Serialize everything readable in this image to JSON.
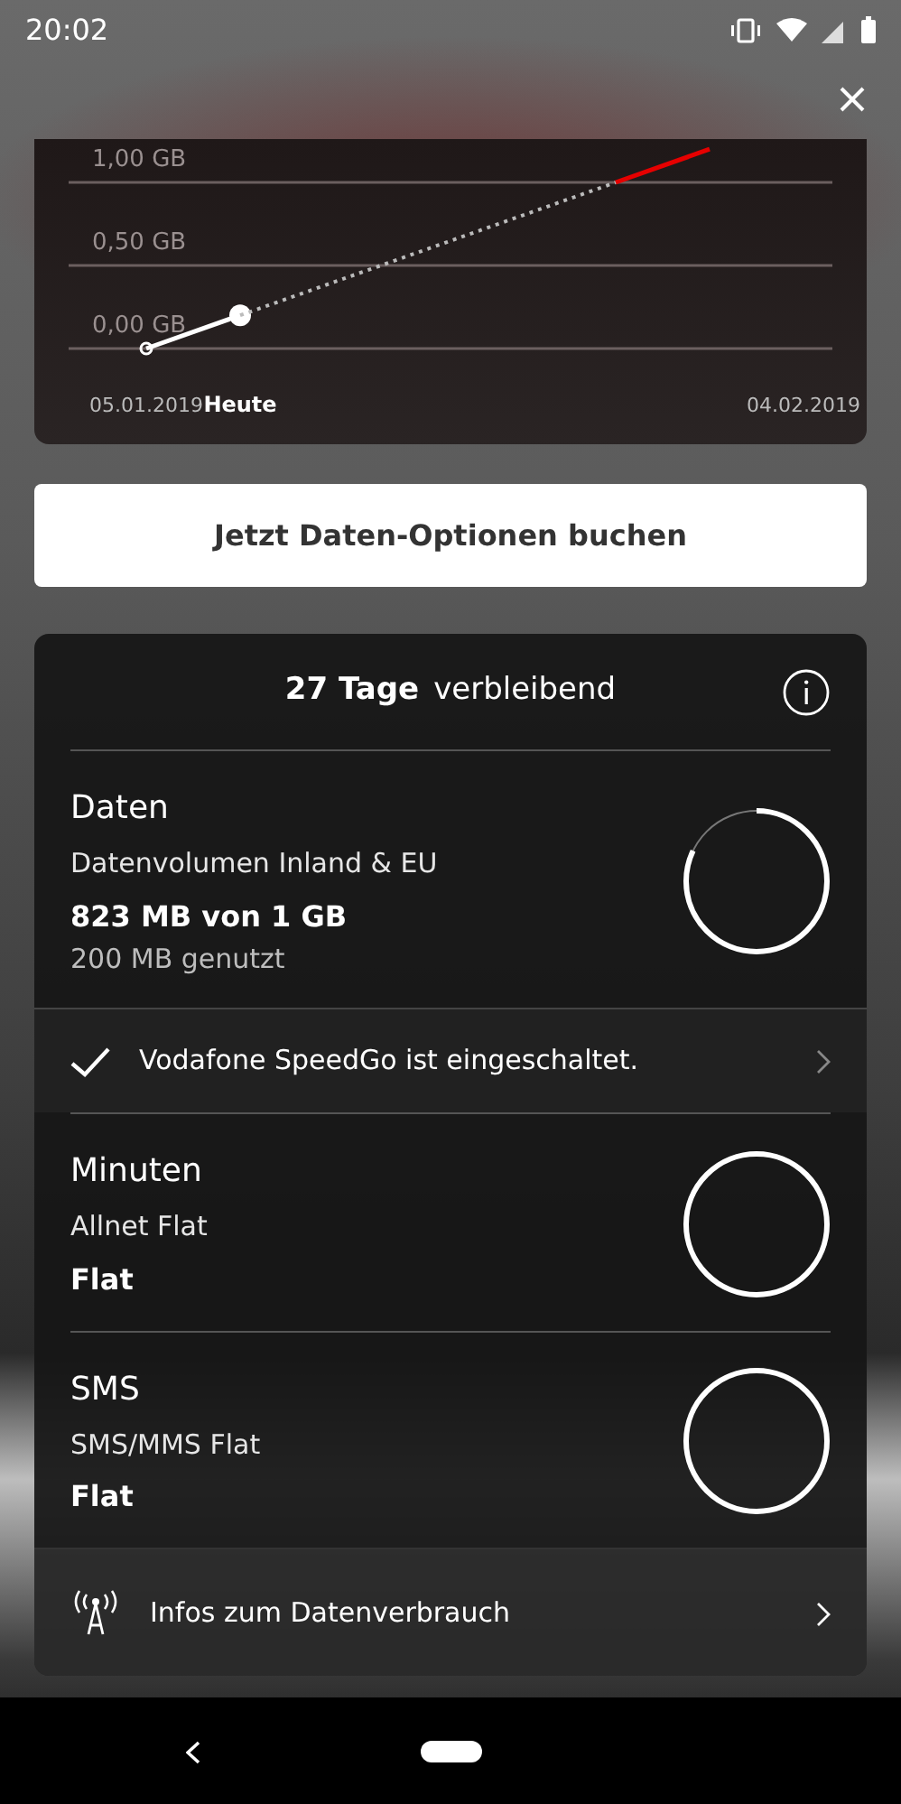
{
  "status_bar": {
    "time": "20:02"
  },
  "chart_card": {
    "chart_data": {
      "type": "line",
      "categories": [
        "05.01.2019",
        "Heute",
        null,
        null,
        null,
        null,
        null,
        "04.02.2019"
      ],
      "yticks": [
        {
          "value": 0,
          "label": "0,00 GB"
        },
        {
          "value": 0.5,
          "label": "0,50 GB"
        },
        {
          "value": 1,
          "label": "1,00 GB"
        }
      ],
      "ylim": [
        0,
        1.25
      ],
      "series": [
        {
          "color": "#ffffff",
          "line_style": "solid",
          "marker": "circle",
          "values": [
            0,
            0.2,
            null,
            null,
            null,
            null,
            null,
            null
          ]
        },
        {
          "color": "#bbbbbb",
          "line_style": "dotted",
          "values": [
            null,
            0.2,
            0.4,
            0.6,
            0.8,
            1.0,
            null,
            null
          ]
        },
        {
          "color": "#e60000",
          "line_style": "solid",
          "values": [
            null,
            null,
            null,
            null,
            null,
            1.0,
            1.2,
            null
          ]
        }
      ]
    }
  },
  "book_button": "Jetzt Daten-Optionen buchen",
  "summary": {
    "days": "27 Tage",
    "days_suffix": "verbleibend",
    "rows": [
      {
        "kind": "usage",
        "title": "Daten",
        "plan": "Datenvolumen Inland & EU",
        "amount": "823 MB von 1 GB",
        "used": "200 MB genutzt"
      },
      {
        "kind": "notice",
        "text": "Vodafone SpeedGo ist eingeschaltet.",
        "checked": true
      },
      {
        "kind": "usage",
        "title": "Minuten",
        "plan": "Allnet Flat",
        "amount": "Flat"
      },
      {
        "kind": "usage",
        "title": "SMS",
        "plan": "SMS/MMS Flat",
        "amount": "Flat"
      },
      {
        "kind": "link",
        "text": "Infos zum Datenverbrauch"
      }
    ]
  }
}
